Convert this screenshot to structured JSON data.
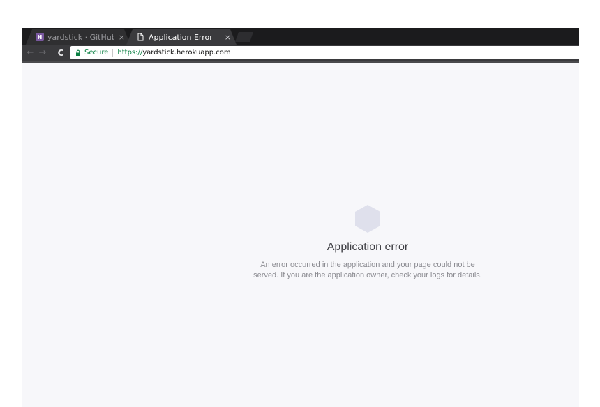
{
  "browser": {
    "tabs": [
      {
        "title": "yardstick · GitHub |",
        "favicon": "H",
        "active": false,
        "close": "×"
      },
      {
        "title": "Application Error",
        "active": true,
        "close": "×"
      }
    ],
    "toolbar": {
      "back": "←",
      "forward": "→",
      "reload": "C"
    },
    "omnibox": {
      "secure_label": "Secure",
      "url_scheme": "https://",
      "url_host": "yardstick.herokuapp.com"
    }
  },
  "page": {
    "error_title": "Application error",
    "error_message_line1": "An error occurred in the application and your page could not be",
    "error_message_line2": "served. If you are the application owner, check your logs for details."
  },
  "colors": {
    "heroku_purple": "#79589f",
    "secure_green": "#0b8043",
    "hex_icon": "#dfe0ec"
  }
}
